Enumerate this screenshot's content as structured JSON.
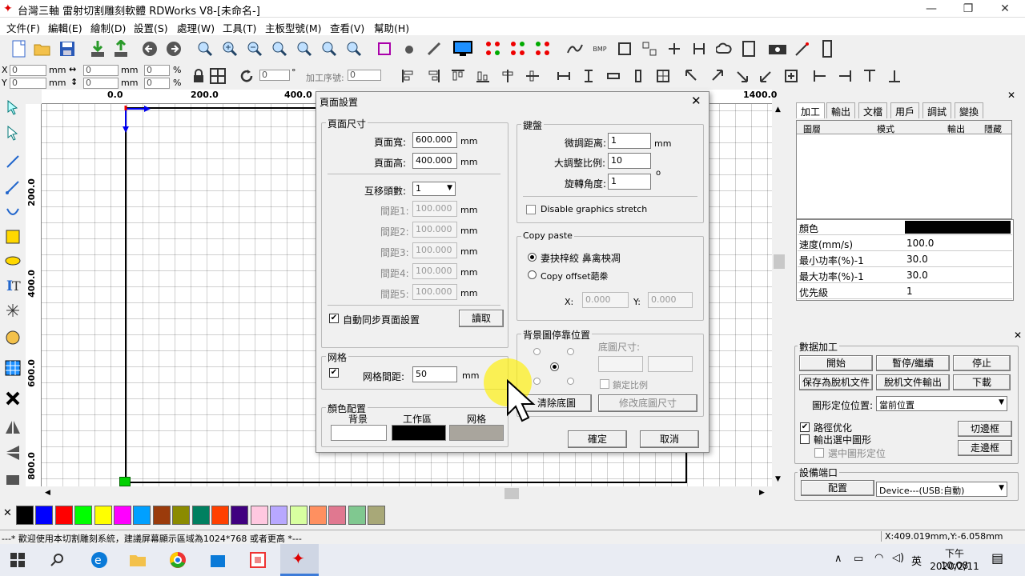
{
  "app": {
    "title": "台灣三軸 雷射切割雕刻軟體 RDWorks V8-[未命名-]"
  },
  "menu": [
    "文件(F)",
    "編輯(E)",
    "繪制(D)",
    "設置(S)",
    "處理(W)",
    "工具(T)",
    "主板型號(M)",
    "查看(V)",
    "幫助(H)"
  ],
  "coords": {
    "x_label": "X",
    "y_label": "Y",
    "x_value": "0",
    "y_value": "0",
    "w_value": "0",
    "h_value": "0",
    "mm": "mm",
    "pct": "%",
    "pct_x": "0",
    "pct_y": "0",
    "angle": "0",
    "deg": "°",
    "order_label": "加工序號:",
    "order_value": "0"
  },
  "ruler": {
    "h": [
      "0.0",
      "200.0",
      "400.0",
      "1400.0"
    ],
    "v": [
      "200.0",
      "400.0",
      "600.0",
      "800.0"
    ]
  },
  "palette": [
    "#000000",
    "#0000ff",
    "#ff0000",
    "#00ff00",
    "#ffff00",
    "#ff00ff",
    "#00a0ff",
    "#9b3b0b",
    "#8b8b00",
    "#008060",
    "#ff4000",
    "#400080",
    "#ffc8e0",
    "#b8a8ff",
    "#d8ffa0",
    "#ff9060",
    "#e07890",
    "#80c890",
    "#a8a878"
  ],
  "status": {
    "message": "---*  歡迎使用本切割雕刻系統，建議屏幕顯示區域為1024*768 或者更高 *---",
    "coords": "X:409.019mm,Y:-6.058mm"
  },
  "taskbar": {
    "time": "下午 10:08",
    "date": "2020/2/11",
    "ime": "英"
  },
  "right_panel": {
    "tabs": [
      "加工",
      "輸出",
      "文檔",
      "用戶",
      "調試",
      "變換"
    ],
    "grid_headers": [
      "圖層",
      "模式",
      "輸出",
      "隱藏"
    ],
    "props": [
      {
        "k": "顏色",
        "v": ""
      },
      {
        "k": "速度(mm/s)",
        "v": "100.0"
      },
      {
        "k": "最小功率(%)-1",
        "v": "30.0"
      },
      {
        "k": "最大功率(%)-1",
        "v": "30.0"
      },
      {
        "k": "优先級",
        "v": "1"
      }
    ],
    "color_value": "#000000"
  },
  "data_panel": {
    "title": "數据加工",
    "start": "開始",
    "pause": "暫停/繼續",
    "stop": "停止",
    "save_offline": "保存為脫机文件",
    "offline_output": "脫机文件輸出",
    "download": "下載",
    "position_label": "圖形定位位置:",
    "position_value": "當前位置",
    "path_opt": "路徑优化",
    "output_selected": "輸出選中圖形",
    "selected_position": "選中圖形定位",
    "cut_frame": "切邊框",
    "walk_frame": "走邊框",
    "port_title": "設備端口",
    "config": "配置",
    "device": "Device---(USB:自動)"
  },
  "dialog": {
    "title": "頁面設置",
    "page_size": {
      "title": "頁面尺寸",
      "width_label": "頁面寬:",
      "width": "600.000",
      "height_label": "頁面高:",
      "height": "400.000",
      "unit": "mm"
    },
    "heads": {
      "label": "互移頭數:",
      "value": "1"
    },
    "spacings": [
      {
        "label": "間距1:",
        "value": "100.000"
      },
      {
        "label": "間距2:",
        "value": "100.000"
      },
      {
        "label": "間距3:",
        "value": "100.000"
      },
      {
        "label": "間距4:",
        "value": "100.000"
      },
      {
        "label": "間距5:",
        "value": "100.000"
      }
    ],
    "auto_sync": "自動同步頁面設置",
    "read": "讀取",
    "grid": {
      "title": "网格",
      "spacing_label": "网格間距:",
      "spacing": "50",
      "unit": "mm"
    },
    "color_cfg": {
      "title": "顏色配置",
      "bg": "背景",
      "work": "工作區",
      "grid": "网格",
      "bg_color": "#ffffff",
      "work_color": "#000000",
      "grid_color": "#a9a59d"
    },
    "keys": {
      "title": "鍵盤",
      "fine_label": "微調距离:",
      "fine": "1",
      "fine_unit": "mm",
      "ratio_label": "大調整比例:",
      "ratio": "10",
      "rot_label": "旋轉角度:",
      "rot": "1",
      "rot_unit": "o",
      "disable_stretch": "Disable graphics stretch"
    },
    "copy": {
      "title": "Copy  paste",
      "opt1": "妻抉梓絞   鼻禽柍凋",
      "opt2": "Copy offset葩桊",
      "x_label": "X:",
      "x": "0.000",
      "y_label": "Y:",
      "y": "0.000"
    },
    "bg_pos": {
      "title": "背景圖停靠位置",
      "size_label": "底圖尺寸:",
      "lock_ratio": "鎖定比例",
      "clear": "清除底圖",
      "modify": "修改底圖尺寸"
    },
    "ok": "確定",
    "cancel": "取消"
  }
}
